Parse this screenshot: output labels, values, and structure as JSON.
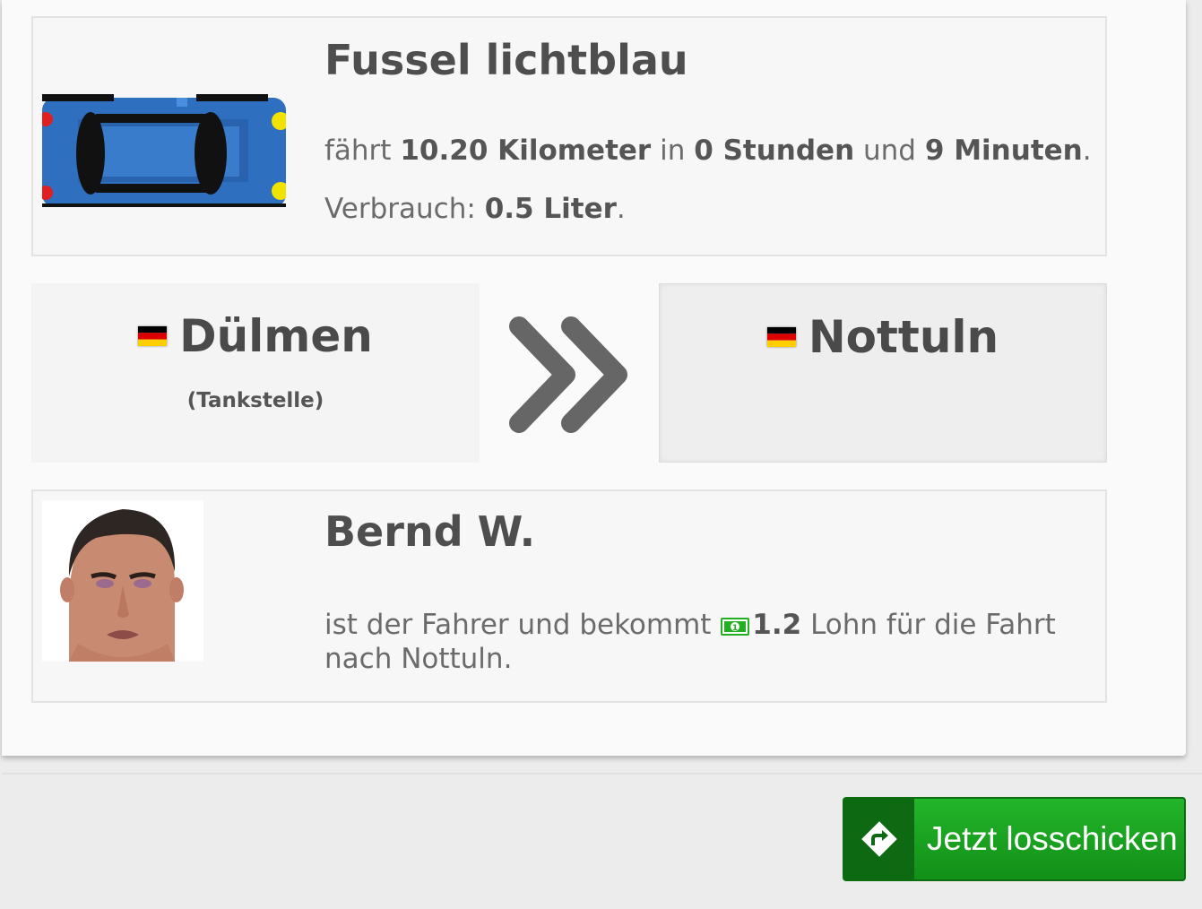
{
  "vehicle": {
    "name": "Fussel lichtblau",
    "text_prefix": "fährt",
    "distance": "10.20 Kilometer",
    "text_in": "in",
    "hours": "0 Stunden",
    "text_and": "und",
    "minutes": "9 Minuten",
    "text_end": ".",
    "consumption_label": "Verbrauch:",
    "consumption_value": "0.5 Liter",
    "consumption_end": ".",
    "icon": "car-topview"
  },
  "route": {
    "from": {
      "name": "Dülmen",
      "sub": "(Tankstelle)",
      "flag": "de-flag-icon"
    },
    "to": {
      "name": "Nottuln",
      "flag": "de-flag-icon"
    },
    "arrow_icon": "double-chevron-right-icon"
  },
  "driver": {
    "name": "Bernd W.",
    "text_prefix": "ist der Fahrer und bekommt",
    "wage": "1.2",
    "text_suffix": "Lohn für die Fahrt nach Nottuln.",
    "money_icon": "money-icon"
  },
  "action": {
    "button_label": "Jetzt losschicken",
    "button_icon": "route-sign-icon"
  },
  "colors": {
    "button_green": "#1aa321",
    "money_green": "#22b022",
    "car_blue": "#2f6fbf"
  }
}
